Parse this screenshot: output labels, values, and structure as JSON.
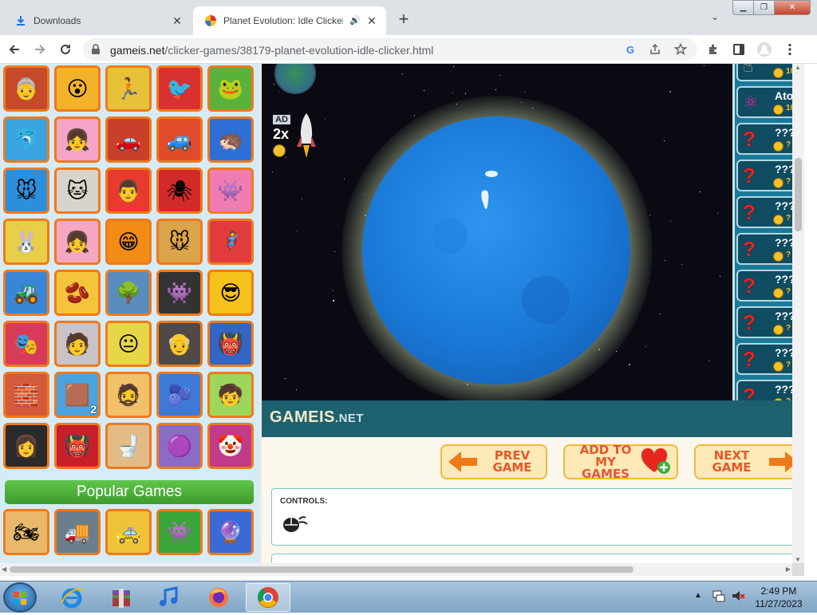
{
  "browser": {
    "tabs": [
      {
        "label": "Downloads",
        "icon": "download-icon",
        "active": false
      },
      {
        "label": "Planet Evolution: Idle Clicker",
        "icon": "gameis-favicon",
        "active": true,
        "audio": "speaker-icon"
      }
    ],
    "url_host": "gameis.net",
    "url_path": "/clicker-games/38179-planet-evolution-idle-clicker.html"
  },
  "sidebar": {
    "thumbnails": [
      {
        "label": "granny",
        "color": "#c44a2a",
        "glyph": "👵"
      },
      {
        "label": "lego",
        "color": "#f2b22a",
        "glyph": "😮"
      },
      {
        "label": "subway",
        "color": "#e8c13a",
        "glyph": "🏃"
      },
      {
        "label": "angry-bird",
        "color": "#d93030",
        "glyph": "🐦"
      },
      {
        "label": "cut-the-rope",
        "color": "#58b23c",
        "glyph": "🐸"
      },
      {
        "label": "dolphin",
        "color": "#3aa4e0",
        "glyph": "🐬"
      },
      {
        "label": "princess",
        "color": "#f5a6c8",
        "glyph": "👧"
      },
      {
        "label": "cars",
        "color": "#c8402a",
        "glyph": "🚗"
      },
      {
        "label": "blaze",
        "color": "#e24b2a",
        "glyph": "🚙"
      },
      {
        "label": "sonic",
        "color": "#2d6fd6",
        "glyph": "🦔"
      },
      {
        "label": "mouse",
        "color": "#2c8fdc",
        "glyph": "🐭"
      },
      {
        "label": "cat",
        "color": "#d8d4cc",
        "glyph": "🐱"
      },
      {
        "label": "mario",
        "color": "#e63b2e",
        "glyph": "👨"
      },
      {
        "label": "spiderman",
        "color": "#d22a2a",
        "glyph": "🕷"
      },
      {
        "label": "pink-monster",
        "color": "#f07cb2",
        "glyph": "👾"
      },
      {
        "label": "rabbit",
        "color": "#e9cf47",
        "glyph": "🐰"
      },
      {
        "label": "girl",
        "color": "#f6a7c4",
        "glyph": "👧"
      },
      {
        "label": "smile",
        "color": "#f28c17",
        "glyph": "😁"
      },
      {
        "label": "tom-jerry",
        "color": "#dba34a",
        "glyph": "🐭"
      },
      {
        "label": "titans",
        "color": "#e13b3b",
        "glyph": "🦸"
      },
      {
        "label": "tractor",
        "color": "#3a86d6",
        "glyph": "🚜"
      },
      {
        "label": "fall-guys",
        "color": "#f4c53a",
        "glyph": "🫘"
      },
      {
        "label": "tree-monster",
        "color": "#5a8cbf",
        "glyph": "🌳"
      },
      {
        "label": "among-us",
        "color": "#333333",
        "glyph": "👾"
      },
      {
        "label": "brawl",
        "color": "#f4c21a",
        "glyph": "😎"
      },
      {
        "label": "squid",
        "color": "#d83a5a",
        "glyph": "🎭"
      },
      {
        "label": "anime",
        "color": "#c9c2c6",
        "glyph": "🧑"
      },
      {
        "label": "baldi",
        "color": "#e8d64a",
        "glyph": "😐"
      },
      {
        "label": "granny2",
        "color": "#4f4a48",
        "glyph": "👴"
      },
      {
        "label": "huggy",
        "color": "#3465c4",
        "glyph": "👹"
      },
      {
        "label": "roblox",
        "color": "#d35a3a",
        "glyph": "🧱"
      },
      {
        "label": "noob",
        "color": "#4aa3de",
        "glyph": "🟫",
        "badge": "2"
      },
      {
        "label": "neighbor",
        "color": "#f1c16a",
        "glyph": "🧔"
      },
      {
        "label": "rainbow",
        "color": "#3d7ad6",
        "glyph": "🫐"
      },
      {
        "label": "toca",
        "color": "#9cd65a",
        "glyph": "🧒"
      },
      {
        "label": "wednesday",
        "color": "#2a2a2a",
        "glyph": "👩"
      },
      {
        "label": "red-monster",
        "color": "#c8202a",
        "glyph": "👹"
      },
      {
        "label": "skibidi",
        "color": "#e2bb86",
        "glyph": "🚽"
      },
      {
        "label": "grimace",
        "color": "#8a6cc6",
        "glyph": "🟣"
      },
      {
        "label": "circus",
        "color": "#c23a8a",
        "glyph": "🤡"
      }
    ],
    "popular_title": "Popular Games",
    "popular_thumbnails": [
      {
        "label": "bikes",
        "color": "#e9b86a",
        "glyph": "🏍"
      },
      {
        "label": "truck",
        "color": "#6b7e8c",
        "glyph": "🚚"
      },
      {
        "label": "taxi",
        "color": "#f0c23a",
        "glyph": "🚕"
      },
      {
        "label": "among-us-2",
        "color": "#3aa63a",
        "glyph": "👾"
      },
      {
        "label": "bubble",
        "color": "#3a6ad6",
        "glyph": "🔮"
      }
    ]
  },
  "game": {
    "ad_label": "AD",
    "multiplier": "2x",
    "upgrades": [
      {
        "title": "",
        "cost": "10",
        "icon": "hand-cursor-icon"
      },
      {
        "title": "Ato",
        "cost": "10",
        "icon": "atom-icon"
      },
      {
        "title": "???",
        "cost": "?",
        "icon": "question-icon"
      },
      {
        "title": "???",
        "cost": "?",
        "icon": "question-icon"
      },
      {
        "title": "???",
        "cost": "?",
        "icon": "question-icon"
      },
      {
        "title": "???",
        "cost": "?",
        "icon": "question-icon"
      },
      {
        "title": "???",
        "cost": "?",
        "icon": "question-icon"
      },
      {
        "title": "???",
        "cost": "?",
        "icon": "question-icon"
      },
      {
        "title": "???",
        "cost": "?",
        "icon": "question-icon"
      },
      {
        "title": "???",
        "cost": "?",
        "icon": "question-icon"
      }
    ]
  },
  "site": {
    "logo_main": "GAMEIS",
    "logo_suffix": ".NET",
    "prev_line1": "PREV",
    "prev_line2": "GAME",
    "add_line1": "ADD TO",
    "add_line2": "MY GAMES",
    "next_line1": "NEXT",
    "next_line2": "GAME",
    "controls_label": "CONTROLS:"
  },
  "taskbar": {
    "time": "2:49 PM",
    "date": "11/27/2023"
  },
  "colors": {
    "accent_orange": "#f07a1a",
    "game_panel": "#1b7a9a",
    "planet": "#1a78d6"
  }
}
